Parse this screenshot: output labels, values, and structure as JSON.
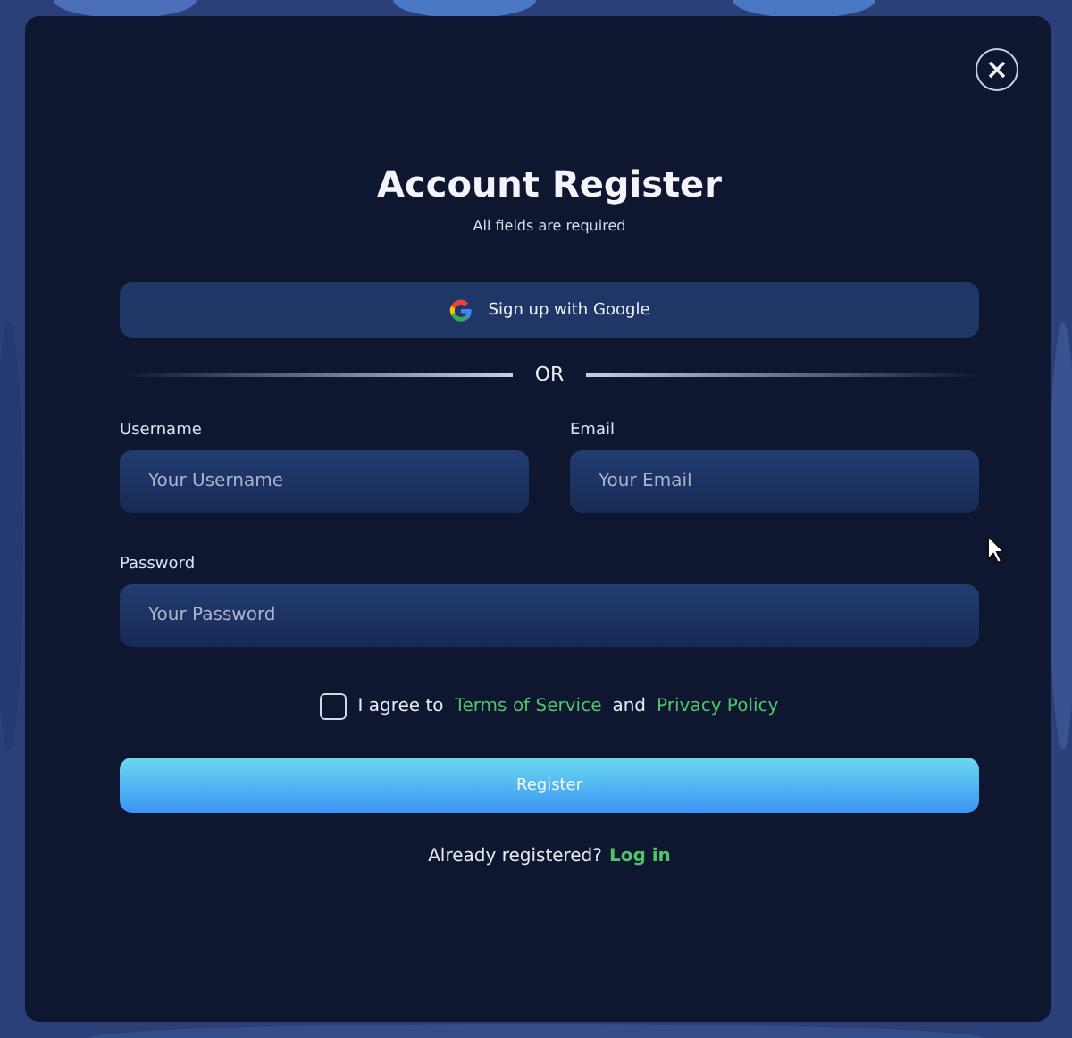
{
  "dialog": {
    "title": "Account Register",
    "subtitle": "All fields are required"
  },
  "google_button": {
    "label": "Sign up with Google"
  },
  "divider": {
    "label": "OR"
  },
  "fields": [
    {
      "label": "Username",
      "placeholder": "Your Username"
    },
    {
      "label": "Email",
      "placeholder": "Your Email"
    },
    {
      "label": "Password",
      "placeholder": "Your Password"
    }
  ],
  "agreement": {
    "checked": false,
    "text": "I agree to",
    "terms_link": "Terms of Service",
    "joiner": "and",
    "privacy_link": "Privacy Policy"
  },
  "register_button": {
    "label": "Register"
  },
  "login_prompt": {
    "text": "Already registered?",
    "link": "Log in"
  }
}
